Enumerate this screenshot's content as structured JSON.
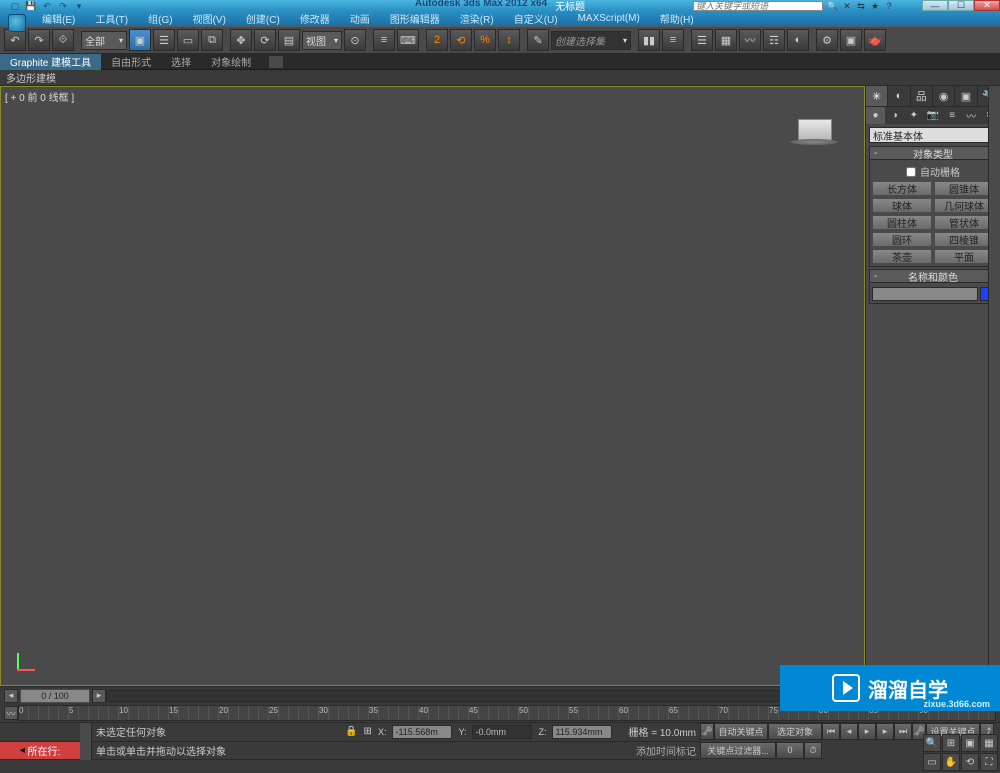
{
  "title": {
    "app": "Autodesk 3ds Max  2012 x64",
    "doc": "无标题"
  },
  "search": {
    "placeholder": "键入关键字或短语"
  },
  "menu": [
    "编辑(E)",
    "工具(T)",
    "组(G)",
    "视图(V)",
    "创建(C)",
    "修改器",
    "动画",
    "图形编辑器",
    "渲染(R)",
    "自定义(U)",
    "MAXScript(M)",
    "帮助(H)"
  ],
  "toolbar": {
    "filter": "全部",
    "view": "视图",
    "setcombo": "创建选择集"
  },
  "graphite": {
    "tabs": [
      "Graphite 建模工具",
      "自由形式",
      "选择",
      "对象绘制"
    ],
    "polyLabel": "多边形建模"
  },
  "viewport": {
    "label": "[ + 0 前 0 线框 ]"
  },
  "cmdpanel": {
    "catcombo": "标准基本体",
    "objTypeHdr": "对象类型",
    "autoGrid": "自动栅格",
    "objects": [
      "长方体",
      "圆锥体",
      "球体",
      "几何球体",
      "圆柱体",
      "管状体",
      "圆环",
      "四棱锥",
      "茶壶",
      "平面"
    ],
    "nameColorHdr": "名称和颜色"
  },
  "timeslider": {
    "handle": "0 / 100"
  },
  "trackbar": {
    "ticks": [
      0,
      5,
      10,
      15,
      20,
      25,
      30,
      35,
      40,
      45,
      50,
      55,
      60,
      65,
      70,
      75,
      80,
      85,
      90
    ]
  },
  "status": {
    "prompt1": "未选定任何对象",
    "prompt2": "单击或单击并拖动以选择对象",
    "addTag": "添加时间标记",
    "curRow": "所在行:",
    "x": "-115.568m",
    "y": "-0.0mm",
    "z": "115.934mm",
    "grid": "栅格 = 10.0mm",
    "autoKey": "自动关键点",
    "setKey": "设置关键点",
    "selSet": "选定对象",
    "keyFilter": "关键点过滤器..."
  },
  "watermark": {
    "brand": "溜溜自学",
    "url": "zixue.3d66.com"
  }
}
